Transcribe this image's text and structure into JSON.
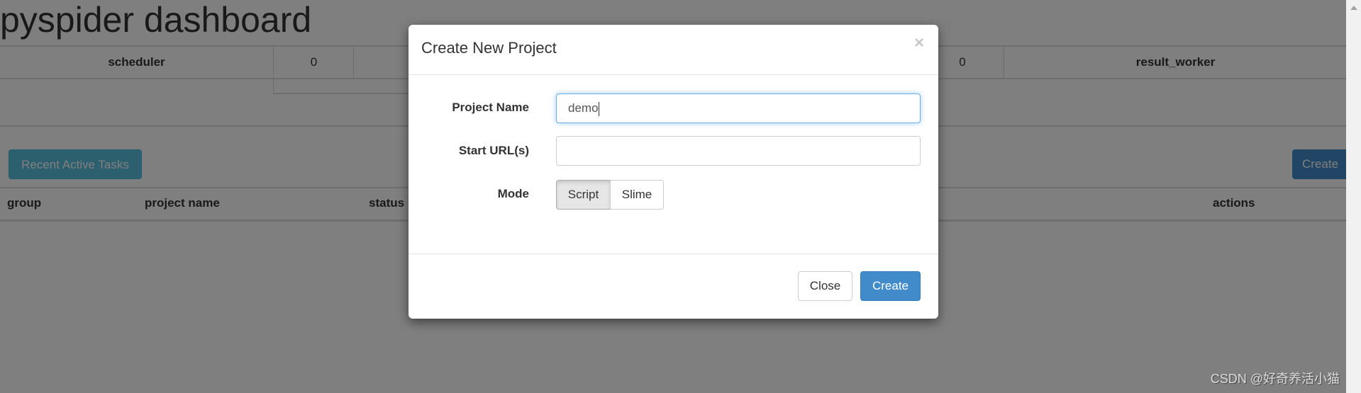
{
  "page": {
    "title": "pyspider dashboard"
  },
  "queues": {
    "scheduler_label": "scheduler",
    "scheduler_count": "0",
    "result_count": "0",
    "result_worker_label": "result_worker"
  },
  "toolbar": {
    "recent_tasks_label": "Recent Active Tasks",
    "create_label": "Create"
  },
  "projects_table": {
    "headers": [
      "group",
      "project name",
      "status",
      "actions"
    ]
  },
  "modal": {
    "title": "Create New Project",
    "close_icon": "×",
    "project_name_label": "Project Name",
    "project_name_value": "demo",
    "start_urls_label": "Start URL(s)",
    "start_urls_value": "",
    "mode_label": "Mode",
    "mode_options": [
      "Script",
      "Slime"
    ],
    "mode_selected": "Script",
    "close_label": "Close",
    "create_label": "Create",
    "colors": {
      "primary": "#428bca",
      "focus_border": "#66afe9"
    }
  },
  "watermark": "CSDN @好奇养活小猫"
}
